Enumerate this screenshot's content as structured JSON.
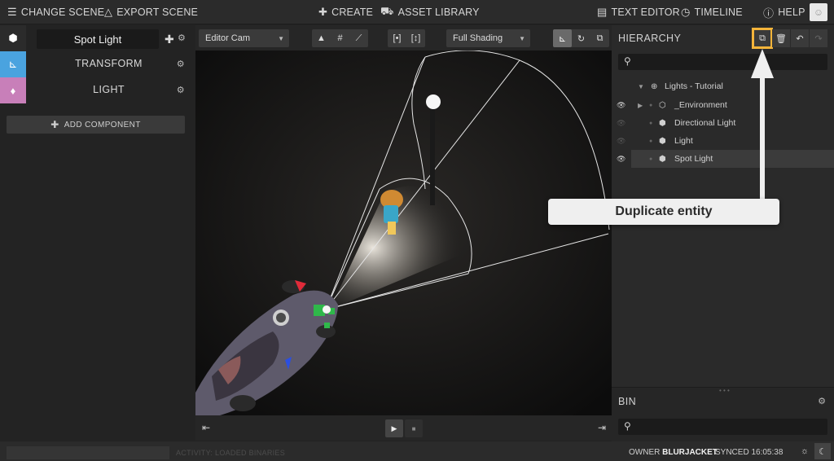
{
  "topbar": {
    "change_scene": "CHANGE SCENE",
    "export_scene": "EXPORT SCENE",
    "create": "CREATE",
    "asset_library": "ASSET LIBRARY",
    "text_editor": "TEXT EDITOR",
    "timeline": "TIMELINE",
    "help": "HELP"
  },
  "inspector": {
    "entity_name": "Spot Light",
    "components": [
      "TRANSFORM",
      "LIGHT"
    ],
    "add_component": "ADD COMPONENT"
  },
  "viewport_toolbar": {
    "camera": "Editor Cam",
    "shading": "Full Shading"
  },
  "hierarchy": {
    "title": "HIERARCHY",
    "search_placeholder": "",
    "items": [
      {
        "label": "Lights - Tutorial",
        "icon": "globe-icon"
      },
      {
        "label": "_Environment",
        "icon": "hexagon-icon"
      },
      {
        "label": "Directional Light",
        "icon": "light-entity-icon"
      },
      {
        "label": "Light",
        "icon": "light-entity-icon"
      },
      {
        "label": "Spot Light",
        "icon": "light-entity-icon",
        "selected": true
      }
    ]
  },
  "bin": {
    "title": "BIN",
    "search_placeholder": ""
  },
  "callout": {
    "text": "Duplicate entity"
  },
  "statusbar": {
    "activity": "ACTIVITY: LOADED BINARIES",
    "owner_label": "OWNER",
    "owner_name": "BLURJACKET",
    "synced": "SYNCED 16:05:38"
  },
  "colors": {
    "transform_accent": "#4aa3df",
    "light_accent": "#c87fb9",
    "highlight": "#f4b43a",
    "background": "#232323"
  }
}
